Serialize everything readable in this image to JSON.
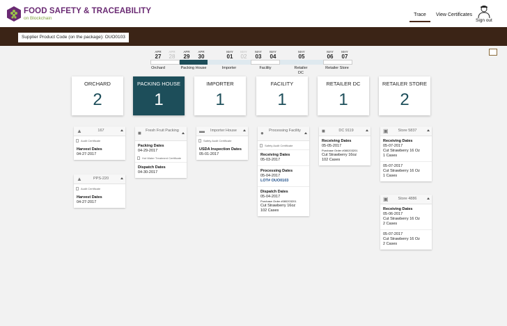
{
  "header": {
    "title": "FOOD SAFETY & TRACEABILITY",
    "subtitle": "on Blockchain",
    "nav": {
      "trace": "Trace",
      "certificates": "View Certificates",
      "signout": "Sign out"
    }
  },
  "search": {
    "label": "Supplier Product Code (on the package): OUO0103"
  },
  "timeline": {
    "dates": [
      {
        "month": "APR",
        "day": "27"
      },
      {
        "month": "APR",
        "day": "28"
      },
      {
        "month": "APR",
        "day": "29"
      },
      {
        "month": "APR",
        "day": "30"
      },
      {
        "month": "MAY",
        "day": "01"
      },
      {
        "month": "MAY",
        "day": "02"
      },
      {
        "month": "MAY",
        "day": "03"
      },
      {
        "month": "MAY",
        "day": "04"
      },
      {
        "month": "MAY",
        "day": "05"
      },
      {
        "month": "MAY",
        "day": "06"
      },
      {
        "month": "MAY",
        "day": "07"
      }
    ],
    "stage_labels": [
      "Orchard",
      "Packing House",
      "Importer",
      "Facility",
      "Retailer DC",
      "Retailer Store"
    ]
  },
  "stages": [
    {
      "name": "ORCHARD",
      "count": "2"
    },
    {
      "name": "PACKING HOUSE",
      "count": "1"
    },
    {
      "name": "IMPORTER",
      "count": "1"
    },
    {
      "name": "FACILITY",
      "count": "1"
    },
    {
      "name": "RETAILER DC",
      "count": "1"
    },
    {
      "name": "RETAILER STORE",
      "count": "2"
    }
  ],
  "cards": {
    "orchard1": {
      "title": "167",
      "cert": "Audit Certificate",
      "s1_t": "Harvest Dates",
      "s1_v": "04-27-2017"
    },
    "orchard2": {
      "title": "PPS-220",
      "cert": "Audit Certificate",
      "s1_t": "Harvest Dates",
      "s1_v": "04-27-2017"
    },
    "packing": {
      "title": "Fresh Fruit Packing",
      "s1_t": "Packing Dates",
      "s1_v": "04-29-2017",
      "cert": "Hot Water Treatment Certificate",
      "s2_t": "Dispatch Dates",
      "s2_v": "04-30-2017"
    },
    "importer": {
      "title": "Importer House",
      "cert": "Safety Audit Certificate",
      "s1_t": "USDA Inspection Dates",
      "s1_v": "05-01-2017"
    },
    "facility": {
      "title": "Processing Facility",
      "cert": "Safety Audit Certificate",
      "s1_t": "Receiving Dates",
      "s1_v": "05-03-2017",
      "s2_t": "Processing Dates",
      "s2_v": "05-04-2017",
      "s2_link": "LOT# OUO0103",
      "s3_t": "Dispatch Dates",
      "s3_v": "05-04-2017",
      "s3_po": "Purchase Order #080203201",
      "s3_item": "Cut Strawberry 16oz",
      "s3_qty": "102 Cases"
    },
    "dc": {
      "title": "DC 9119",
      "s1_t": "Receiving Dates",
      "s1_v": "05-05-2017",
      "s1_po": "Purchase Order #080203201",
      "s1_item": "Cut Strawberry 16oz",
      "s1_qty": "102 Cases"
    },
    "store1": {
      "title": "Store 5837",
      "s1_t": "Receiving Dates",
      "s1_v": "05-07-2017",
      "s1_item": "Cut Strawberry 16 Oz",
      "s1_qty": "1 Cases",
      "s2_v": "05-07-2017",
      "s2_item": "Cut Strawberry 16 Oz",
      "s2_qty": "1 Cases"
    },
    "store2": {
      "title": "Store 4886",
      "s1_t": "Receiving Dates",
      "s1_v": "05-06-2017",
      "s1_item": "Cut Strawberry 16 Oz",
      "s1_qty": "2 Cases",
      "s2_v": "05-07-2017",
      "s2_item": "Cut Strawberry 16 Oz",
      "s2_qty": "2 Cases"
    }
  },
  "colors": {
    "brand_purple": "#6a2a73",
    "brand_green": "#7ea13c",
    "bar_brown": "#3b2416",
    "active_teal": "#1d4e5a"
  }
}
